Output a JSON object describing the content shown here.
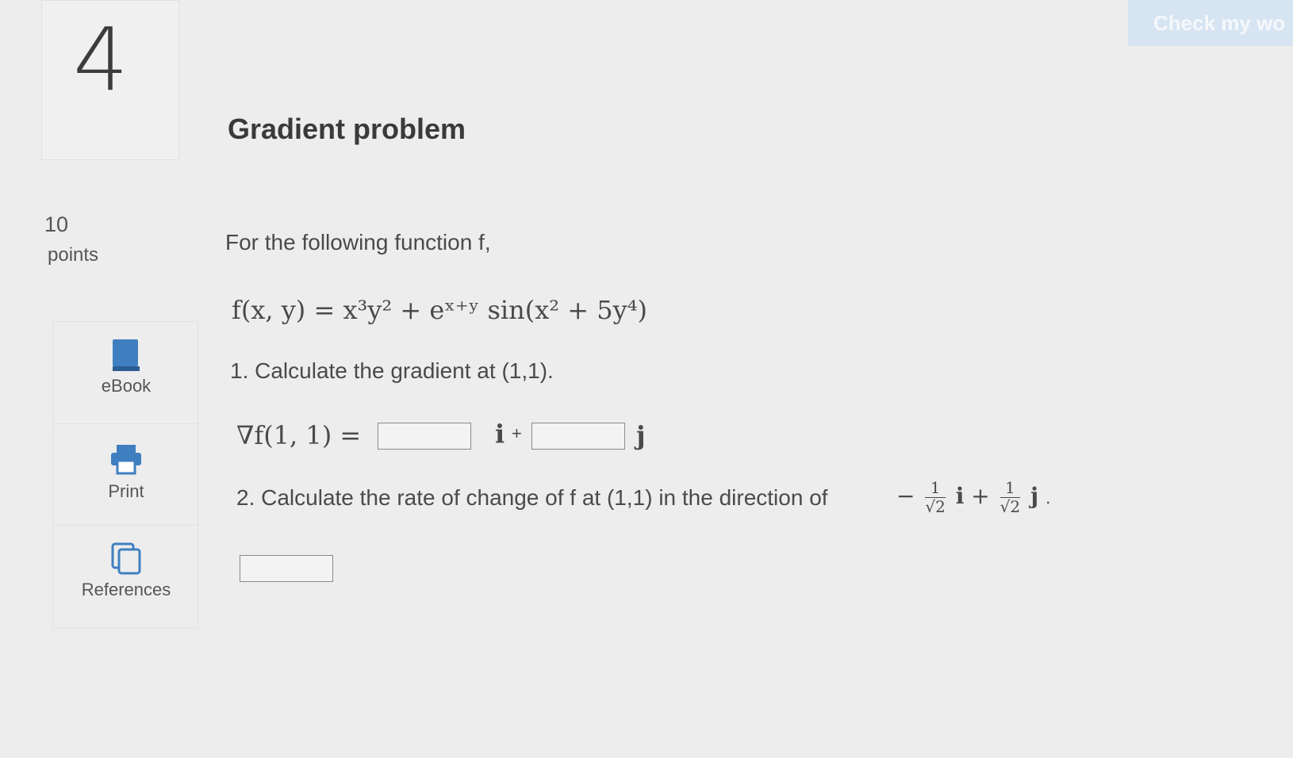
{
  "question": {
    "number": "4",
    "title": "Gradient problem",
    "points_value": "10",
    "points_label": "points",
    "intro": "For the following function f,",
    "function_lhs": "f(x, y) =",
    "function_rhs": "x³y² + eˣ⁺ʸ sin(x² + 5y⁴)",
    "part1_text": "1. Calculate the gradient at (1,1).",
    "gradient_lhs": "∇f(1, 1) =",
    "i_label": "i",
    "plus": "+",
    "j_label": "j",
    "part2_text": "2. Calculate the rate of change of f at (1,1) in the direction of",
    "direction": {
      "minus": "−",
      "numerator": "1",
      "denominator": "√2",
      "i": "i",
      "plus": "+",
      "j": "j",
      "end": "."
    },
    "answers": {
      "grad_i": "",
      "grad_j": "",
      "rate": ""
    }
  },
  "header": {
    "check_button": "Check my wo"
  },
  "tools": {
    "ebook": "eBook",
    "print": "Print",
    "references": "References"
  },
  "colors": {
    "background": "#ededed",
    "ebook_icon": "#3f7fc0",
    "button": "#d7e4f2"
  }
}
